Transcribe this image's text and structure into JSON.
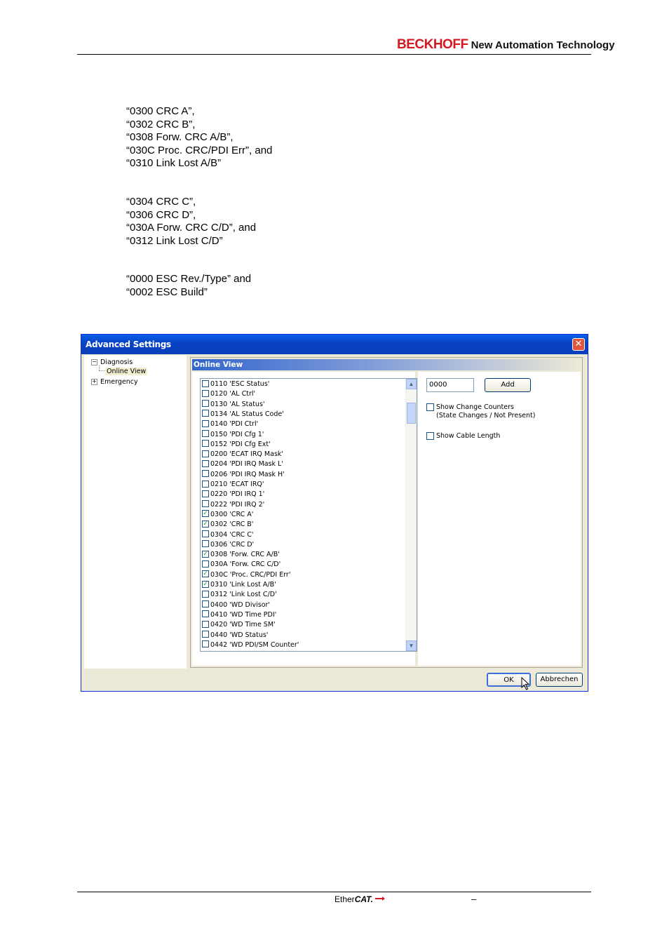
{
  "header": {
    "brand": "BECKHOFF",
    "tagline": "New Automation Technology"
  },
  "text_group_1": [
    "“0300 CRC A”,",
    "“0302 CRC B”,",
    "“0308 Forw. CRC A/B”,",
    "“030C Proc. CRC/PDI Err”, and",
    "“0310 Link Lost A/B”"
  ],
  "text_group_2": [
    "“0304 CRC C”,",
    "“0306 CRC D”,",
    "“030A Forw. CRC C/D”, and",
    "“0312 Link Lost C/D”"
  ],
  "text_group_3": [
    "“0000 ESC Rev./Type” and",
    "“0002 ESC Build”"
  ],
  "dialog": {
    "title": "Advanced Settings",
    "close_glyph": "✕",
    "tree": {
      "diagnosis": {
        "label": "Diagnosis",
        "expander": "−"
      },
      "online_view": {
        "label": "Online View"
      },
      "emergency": {
        "label": "Emergency",
        "expander": "+"
      }
    },
    "group_title": "Online View",
    "register_list": [
      {
        "label": "0110 'ESC Status'",
        "checked": false
      },
      {
        "label": "0120 'AL Ctrl'",
        "checked": false
      },
      {
        "label": "0130 'AL Status'",
        "checked": false
      },
      {
        "label": "0134 'AL Status Code'",
        "checked": false
      },
      {
        "label": "0140 'PDI Ctrl'",
        "checked": false
      },
      {
        "label": "0150 'PDI Cfg 1'",
        "checked": false
      },
      {
        "label": "0152 'PDI Cfg Ext'",
        "checked": false
      },
      {
        "label": "0200 'ECAT IRQ Mask'",
        "checked": false
      },
      {
        "label": "0204 'PDI IRQ Mask L'",
        "checked": false
      },
      {
        "label": "0206 'PDI IRQ Mask H'",
        "checked": false
      },
      {
        "label": "0210 'ECAT IRQ'",
        "checked": false
      },
      {
        "label": "0220 'PDI IRQ 1'",
        "checked": false
      },
      {
        "label": "0222 'PDI IRQ 2'",
        "checked": false
      },
      {
        "label": "0300 'CRC A'",
        "checked": true
      },
      {
        "label": "0302 'CRC B'",
        "checked": true
      },
      {
        "label": "0304 'CRC C'",
        "checked": false
      },
      {
        "label": "0306 'CRC D'",
        "checked": false
      },
      {
        "label": "0308 'Forw. CRC A/B'",
        "checked": true
      },
      {
        "label": "030A 'Forw. CRC C/D'",
        "checked": false
      },
      {
        "label": "030C 'Proc. CRC/PDI Err'",
        "checked": true
      },
      {
        "label": "0310 'Link Lost A/B'",
        "checked": true
      },
      {
        "label": "0312 'Link Lost C/D'",
        "checked": false
      },
      {
        "label": "0400 'WD Divisor'",
        "checked": false
      },
      {
        "label": "0410 'WD Time PDI'",
        "checked": false
      },
      {
        "label": "0420 'WD Time SM'",
        "checked": false
      },
      {
        "label": "0440 'WD Status'",
        "checked": false
      },
      {
        "label": "0442 'WD PDI/SM Counter'",
        "checked": false
      }
    ],
    "address_input": {
      "value": "0000"
    },
    "add_button": "Add",
    "show_change_counters": {
      "label": "Show Change Counters",
      "sublabel": "(State Changes / Not Present)",
      "checked": false
    },
    "show_cable_length": {
      "label": "Show Cable Length",
      "checked": false
    },
    "ok_button": "OK",
    "cancel_button": "Abbrechen",
    "scroll_up_glyph": "▲",
    "scroll_down_glyph": "▼"
  },
  "footer": {
    "logo_ether": "Ether",
    "logo_cat": "CAT.",
    "dash": "–"
  }
}
